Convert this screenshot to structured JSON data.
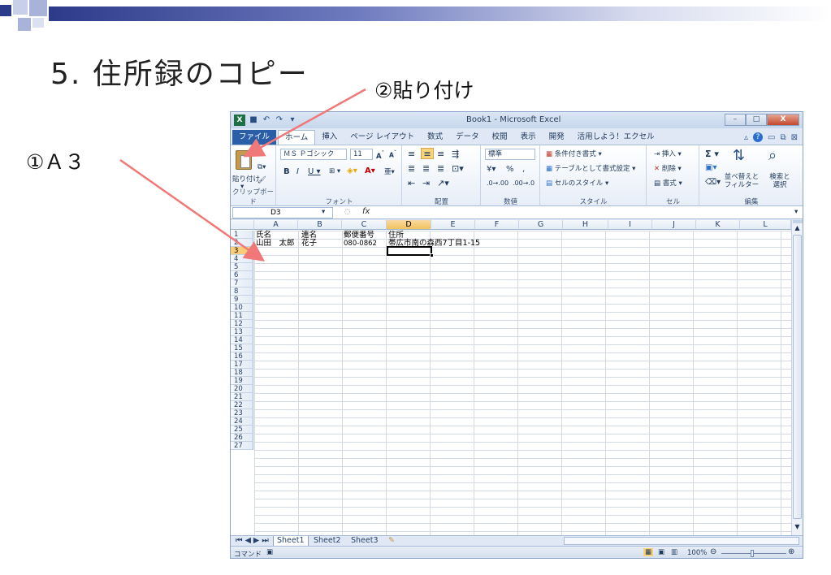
{
  "slide": {
    "title": "5. 住所録のコピー",
    "callout_paste": "②貼り付け",
    "callout_a3": "①Ａ３"
  },
  "colors": {
    "accent": "#2c3a8a",
    "arrow": "#f07878"
  },
  "excel": {
    "window_title": "Book1 - Microsoft Excel",
    "quick_access_icons": [
      "save-icon",
      "undo-icon",
      "redo-icon",
      "customize-icon"
    ],
    "window_controls": {
      "minimize": "–",
      "restore": "□",
      "close": "X"
    },
    "tabs": [
      "ファイル",
      "ホーム",
      "挿入",
      "ページ レイアウト",
      "数式",
      "データ",
      "校閲",
      "表示",
      "開発",
      "活用しよう！エクセル"
    ],
    "active_tab": "ホーム",
    "ribbon": {
      "clipboard": {
        "paste": "貼り付け",
        "label": "クリップボード"
      },
      "font": {
        "name": "ＭＳ Ｐゴシック",
        "size": "11",
        "label": "フォント"
      },
      "alignment": {
        "label": "配置"
      },
      "number": {
        "format": "標準",
        "label": "数値"
      },
      "styles": {
        "conditional": "条件付き書式",
        "table": "テーブルとして書式設定",
        "cell": "セルのスタイル",
        "label": "スタイル"
      },
      "cells": {
        "insert": "挿入",
        "delete": "削除",
        "format": "書式",
        "label": "セル"
      },
      "editing": {
        "sort": "並べ替えと フィルター",
        "find": "検索と 選択",
        "label": "編集"
      }
    },
    "name_box": "D3",
    "formula_symbol": "fx",
    "formula": "",
    "columns": [
      "A",
      "B",
      "C",
      "D",
      "E",
      "F",
      "G",
      "H",
      "I",
      "J",
      "K",
      "L"
    ],
    "selected_column": "D",
    "rows": [
      "1",
      "2",
      "3",
      "4",
      "5",
      "6",
      "7",
      "8",
      "9",
      "10",
      "11",
      "12",
      "13",
      "14",
      "15",
      "16",
      "17",
      "18",
      "19",
      "20",
      "21",
      "22",
      "23",
      "24",
      "25",
      "26",
      "27"
    ],
    "selected_row": "3",
    "cells": {
      "A1": "氏名",
      "B1": "連名",
      "C1": "郵便番号",
      "D1": "住所",
      "A2": "山田　太郎",
      "B2": "花子",
      "C2": "080-0862",
      "D2": "帯広市南の森西7丁目1-15"
    },
    "sheets": [
      "Sheet1",
      "Sheet2",
      "Sheet3"
    ],
    "active_sheet": "Sheet1",
    "status": {
      "mode": "コマンド",
      "zoom": "100%"
    }
  }
}
